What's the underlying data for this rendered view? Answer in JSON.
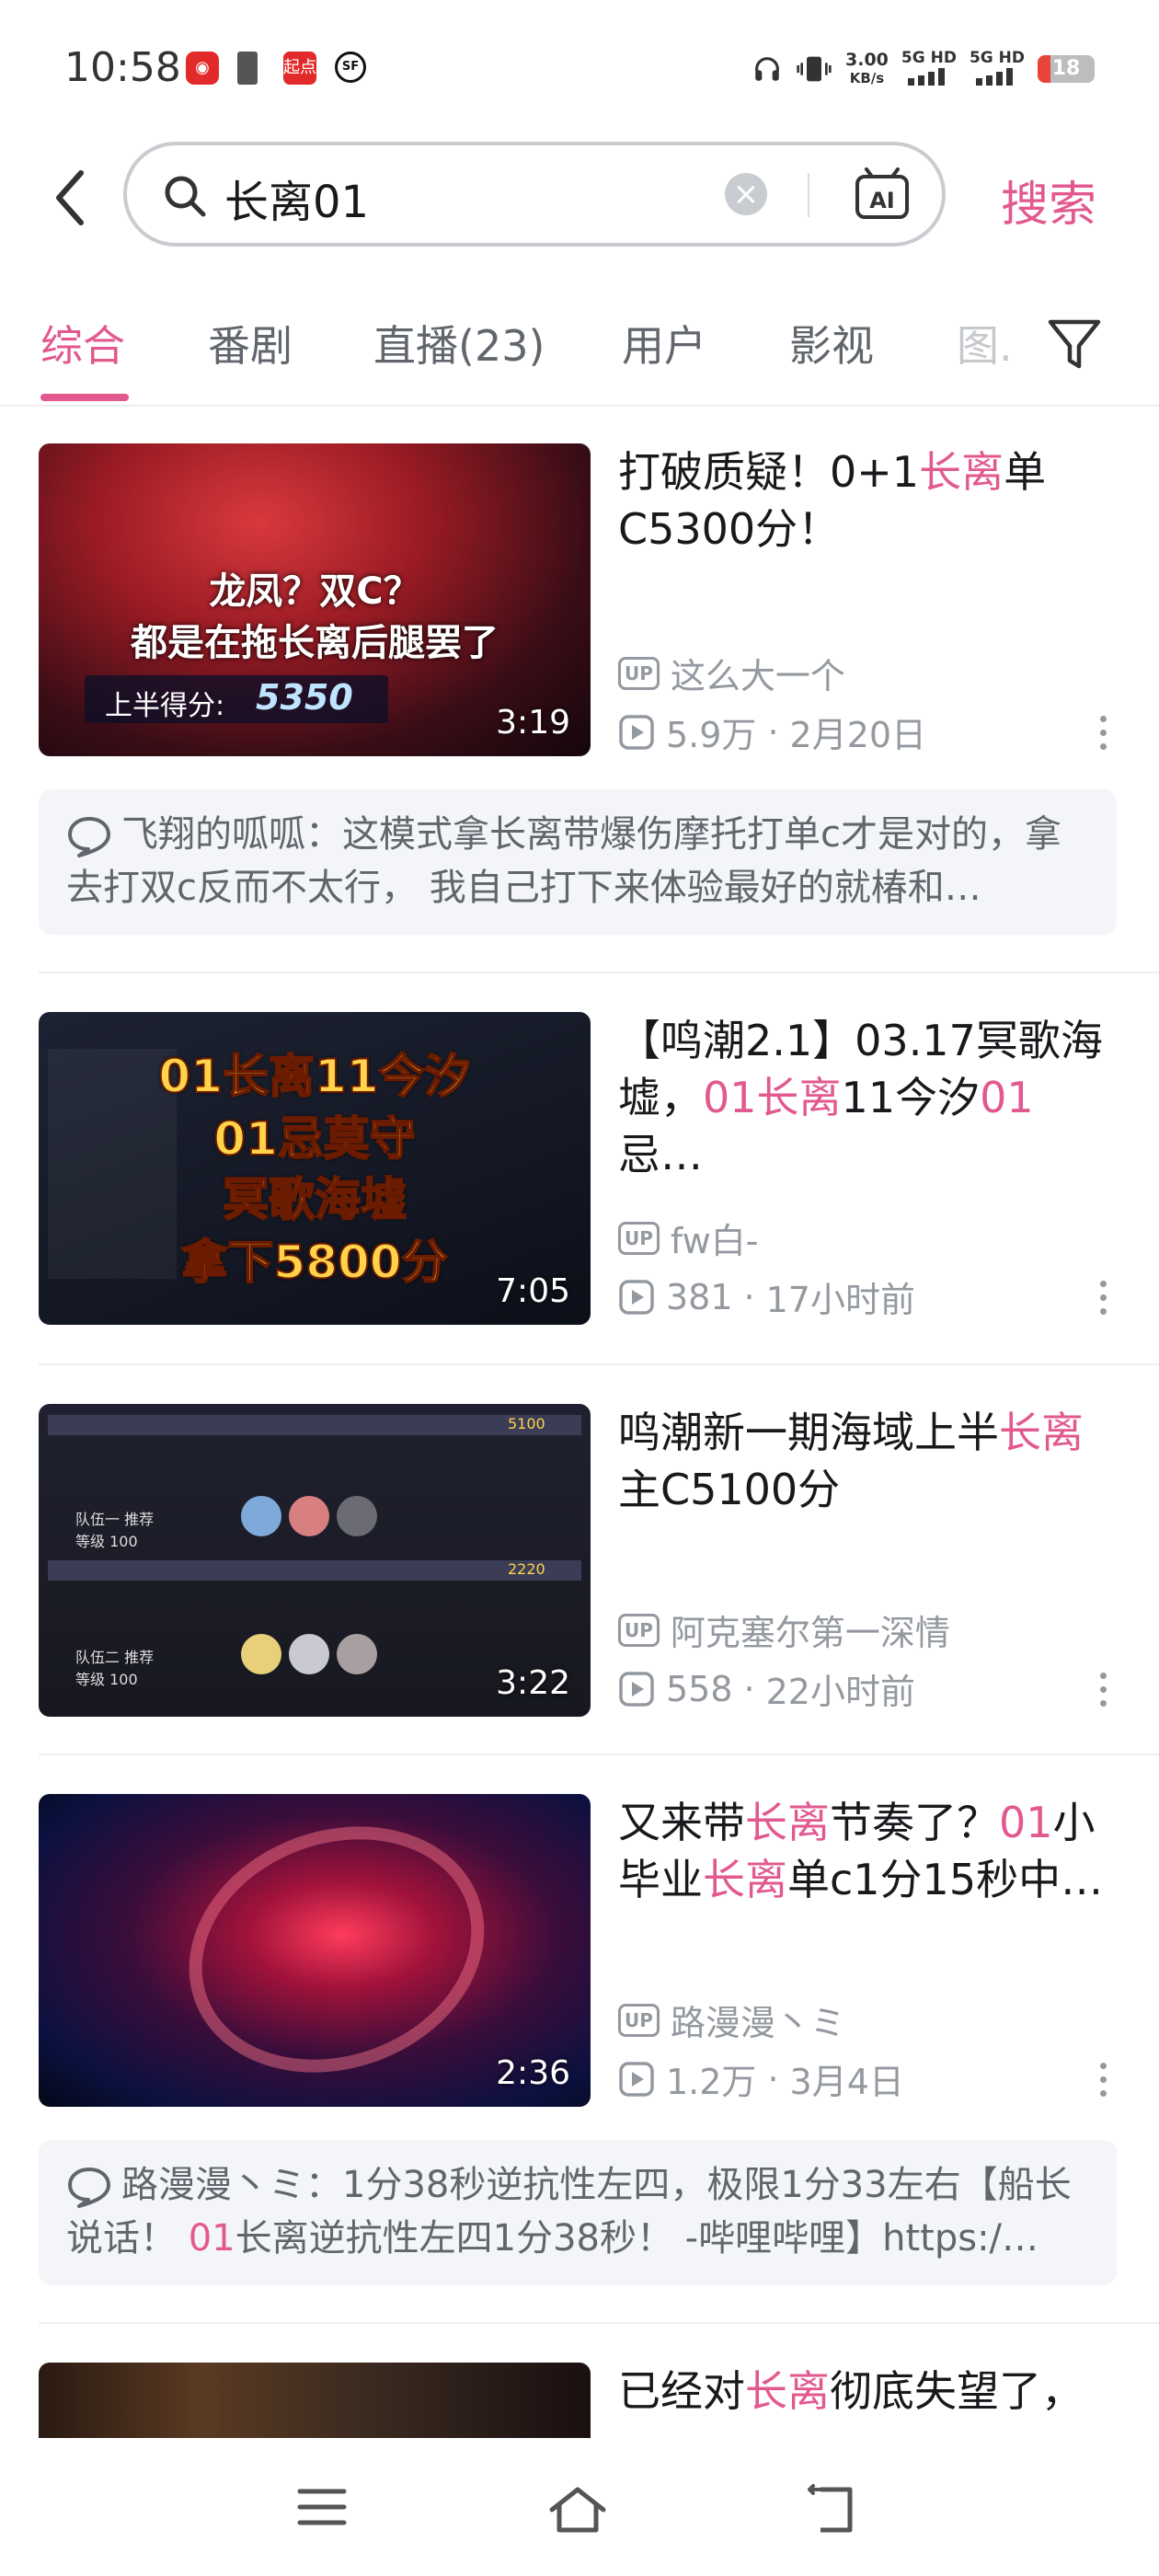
{
  "status_bar": {
    "time": "10:58",
    "app_icons": [
      "netease-music-icon",
      "sim-icon",
      "qidian-icon",
      "sf-icon"
    ],
    "qidian_label": "起点",
    "sf_label": "SF",
    "speed_value": "3.00",
    "speed_unit": "KB/s",
    "net1": "5G HD",
    "net2": "5G HD",
    "battery": "18"
  },
  "search": {
    "query": "长离01",
    "button_label": "搜索"
  },
  "tabs": [
    {
      "label": "综合"
    },
    {
      "label": "番剧"
    },
    {
      "label": "直播(23)"
    },
    {
      "label": "用户"
    },
    {
      "label": "影视"
    },
    {
      "label": "图..."
    }
  ],
  "results": [
    {
      "title_parts": [
        "打破质疑！0+1",
        "长离",
        "单C5300分！"
      ],
      "uploader": "这么大一个",
      "views": "5.9万",
      "date": "2月20日",
      "duration": "3:19",
      "thumb_lines": [
        "龙凤？双C？",
        "都是在拖长离后腿罢了"
      ],
      "thumb_score_label": "上半得分:",
      "thumb_score": "5350",
      "comment": {
        "author": "飞翔的呱呱：",
        "text": "这模式拿长离带爆伤摩托打单c才是对的，拿去打双c反而不太行， 我自己打下来体验最好的就椿和…"
      }
    },
    {
      "title_parts": [
        "【鸣潮2.1】03.17冥歌海墟，",
        "01长离",
        "11今汐",
        "01",
        "忌…"
      ],
      "uploader": "fw白-",
      "views": "381",
      "date": "17小时前",
      "duration": "7:05",
      "thumb_lines": [
        "01长离11今汐",
        "01忌莫守",
        "冥歌海墟",
        "拿下5800分"
      ]
    },
    {
      "title_parts": [
        "鸣潮新一期海域上半",
        "长离",
        "主C5100分"
      ],
      "uploader": "阿克塞尔第一深情",
      "views": "558",
      "date": "22小时前",
      "duration": "3:22",
      "thumb_rows": [
        "队伍一 推荐等级 100",
        "队伍二 推荐等级 100"
      ],
      "thumb_scores": [
        "5100",
        "2220"
      ]
    },
    {
      "title_parts": [
        "又来带",
        "长离",
        "节奏了？",
        "01",
        "小毕业",
        "长离",
        "单c1分15秒中…"
      ],
      "uploader": "路漫漫丶ミ",
      "views": "1.2万",
      "date": "3月4日",
      "duration": "2:36",
      "comment": {
        "author": "路漫漫丶ミ：",
        "text_before": "1分38秒逆抗性左四，极限1分33左右【船长说话！ ",
        "text_hl": "01",
        "text_after": "长离逆抗性左四1分38秒！ -哔哩哔哩】https:/…"
      }
    },
    {
      "title_parts": [
        "已经对",
        "长离",
        "彻底失望了，"
      ]
    }
  ],
  "bottom_nav": [
    "menu-icon",
    "home-icon",
    "back-icon"
  ],
  "colors": {
    "accent": "#e2598f",
    "text": "#18191c",
    "secondary": "#9499a0",
    "comment_bg": "#f4f5f8"
  }
}
